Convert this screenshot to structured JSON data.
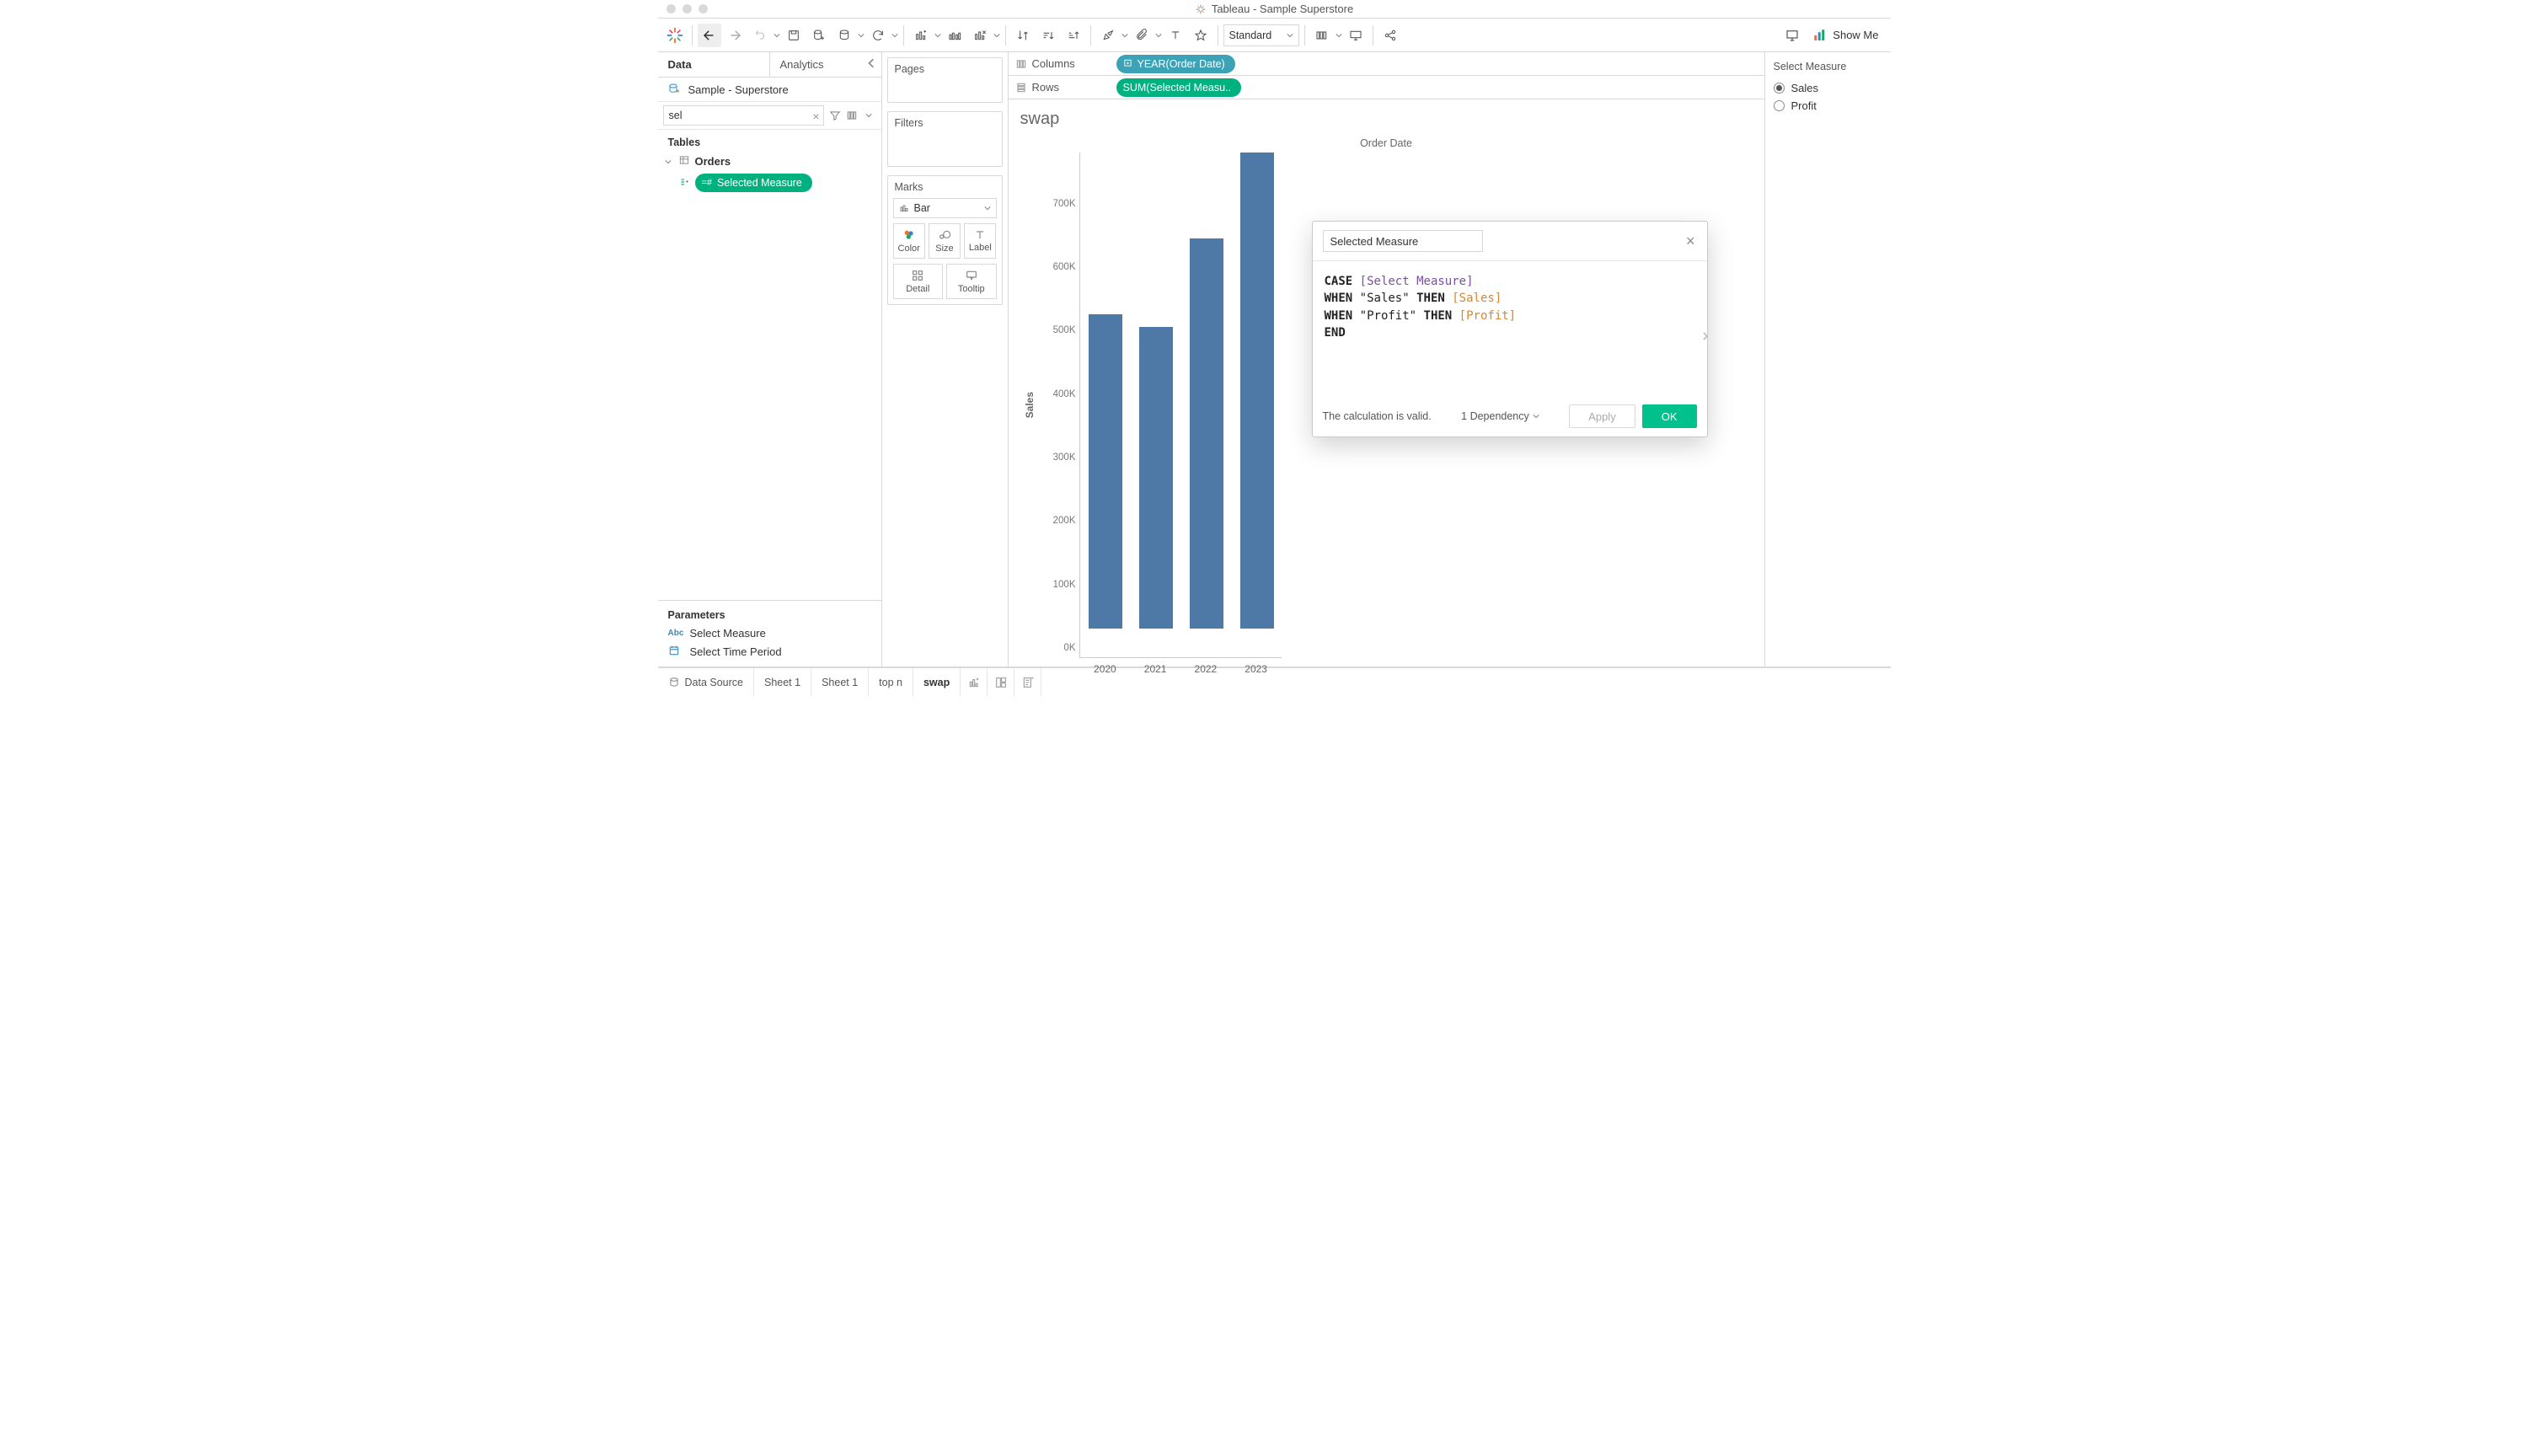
{
  "window": {
    "title": "Tableau - Sample Superstore"
  },
  "toolbar": {
    "fit_mode": "Standard",
    "show_me": "Show Me"
  },
  "left": {
    "tabs": {
      "data": "Data",
      "analytics": "Analytics"
    },
    "datasource": "Sample - Superstore",
    "search_value": "sel",
    "tables_header": "Tables",
    "orders_label": "Orders",
    "selected_measure_pill": "Selected Measure",
    "parameters_header": "Parameters",
    "param1": "Select Measure",
    "param2": "Select Time Period"
  },
  "cards": {
    "pages": "Pages",
    "filters": "Filters",
    "marks": "Marks",
    "mark_type": "Bar",
    "color": "Color",
    "size": "Size",
    "label": "Label",
    "detail": "Detail",
    "tooltip": "Tooltip"
  },
  "shelves": {
    "columns_label": "Columns",
    "rows_label": "Rows",
    "columns_pill": "YEAR(Order Date)",
    "rows_pill": "SUM(Selected Measu.."
  },
  "sheet": {
    "title": "swap"
  },
  "param_control": {
    "title": "Select Measure",
    "options": [
      "Sales",
      "Profit"
    ],
    "selected": "Sales"
  },
  "calc": {
    "name": "Selected Measure",
    "status": "The calculation is valid.",
    "dependency": "1 Dependency",
    "apply": "Apply",
    "ok": "OK",
    "line1_kw": "CASE ",
    "line1_param": "[Select Measure]",
    "line2_kw1": "WHEN ",
    "line2_str": "\"Sales\"",
    "line2_kw2": " THEN ",
    "line2_field": "[Sales]",
    "line3_kw1": "WHEN ",
    "line3_str": "\"Profit\"",
    "line3_kw2": " THEN ",
    "line3_field": "[Profit]",
    "line4_kw": "END"
  },
  "bottom_tabs": {
    "data_source": "Data Source",
    "sheets": [
      "Sheet 1",
      "Sheet 1",
      "top n",
      "swap"
    ]
  },
  "chart_data": {
    "type": "bar",
    "title": "Order Date",
    "xlabel": "",
    "ylabel": "Sales",
    "categories": [
      "2020",
      "2021",
      "2022",
      "2023"
    ],
    "values": [
      495000,
      475000,
      615000,
      750000
    ],
    "ylim": [
      0,
      750000
    ],
    "yticks": [
      0,
      100000,
      200000,
      300000,
      400000,
      500000,
      600000,
      700000
    ],
    "ytick_labels": [
      "0K",
      "100K",
      "200K",
      "300K",
      "400K",
      "500K",
      "600K",
      "700K"
    ]
  }
}
